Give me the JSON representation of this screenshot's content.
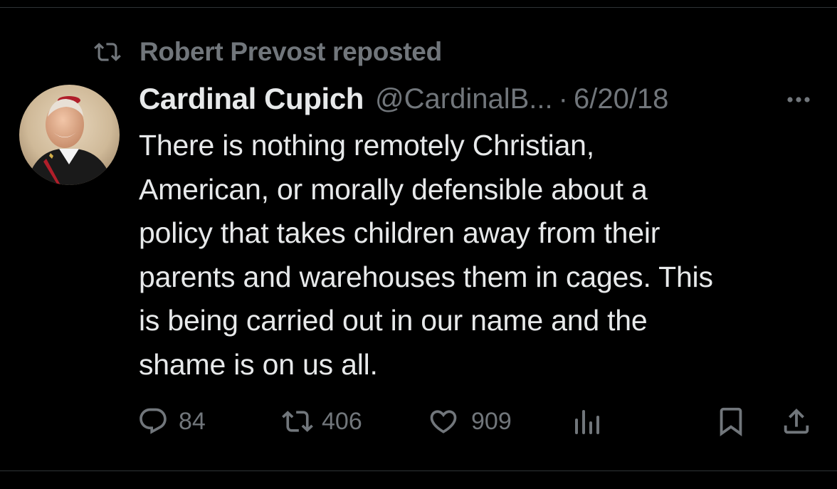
{
  "repost": {
    "text": "Robert Prevost reposted",
    "icon": "repost-icon"
  },
  "tweet": {
    "display_name": "Cardinal Cupich",
    "handle": "@CardinalB...",
    "separator": "·",
    "date": "6/20/18",
    "more_icon": "more-horizontal-icon",
    "text_lines": [
      "There is nothing remotely Christian,",
      "American, or morally defensible about a",
      "policy that takes children away from their",
      "parents and warehouses them in cages. This",
      "is being carried out in our name and the",
      "shame is on us all."
    ]
  },
  "actions": {
    "replies": "84",
    "reposts": "406",
    "likes": "909",
    "reply_icon": "reply-icon",
    "repost_icon": "repost-icon",
    "like_icon": "heart-icon",
    "views_icon": "analytics-icon",
    "bookmark_icon": "bookmark-icon",
    "share_icon": "share-icon"
  },
  "colors": {
    "background": "#000000",
    "primary_text": "#e7e9ea",
    "secondary_text": "#71767b",
    "divider": "#2f3336"
  }
}
